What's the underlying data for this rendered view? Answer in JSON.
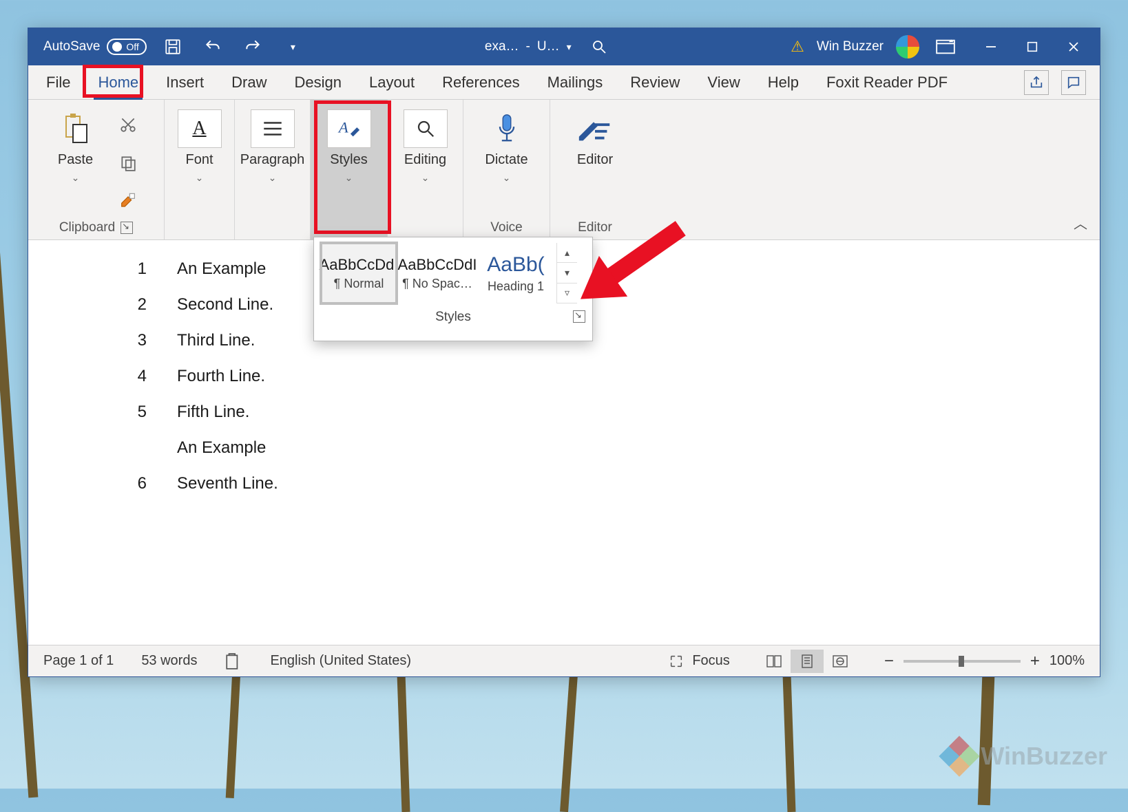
{
  "titlebar": {
    "autosave_label": "AutoSave",
    "autosave_state": "Off",
    "doc_name": "exa…",
    "doc_sep": "-",
    "doc_save": "U…",
    "user_name": "Win Buzzer"
  },
  "tabs": {
    "items": [
      "File",
      "Home",
      "Insert",
      "Draw",
      "Design",
      "Layout",
      "References",
      "Mailings",
      "Review",
      "View",
      "Help",
      "Foxit Reader PDF"
    ],
    "active_index": 1
  },
  "ribbon": {
    "clipboard": {
      "paste": "Paste",
      "group_label": "Clipboard"
    },
    "font": {
      "label": "Font"
    },
    "paragraph": {
      "label": "Paragraph"
    },
    "styles": {
      "label": "Styles"
    },
    "editing": {
      "label": "Editing"
    },
    "dictate": {
      "label": "Dictate",
      "group_label": "Voice"
    },
    "editor": {
      "label": "Editor",
      "group_label": "Editor"
    }
  },
  "styles_gallery": {
    "sample_text": "AaBbCcDdI",
    "heading_sample": "AaBb(",
    "items": [
      {
        "name": "¶ Normal"
      },
      {
        "name": "¶ No Spac…"
      },
      {
        "name": "Heading 1"
      }
    ],
    "footer": "Styles"
  },
  "document": {
    "lines": [
      {
        "n": "1",
        "t": "An Example"
      },
      {
        "n": "2",
        "t": "Second Line."
      },
      {
        "n": "3",
        "t": "Third Line."
      },
      {
        "n": "4",
        "t": "Fourth Line."
      },
      {
        "n": "5",
        "t": "Fifth Line."
      },
      {
        "n": "",
        "t": "An Example"
      },
      {
        "n": "6",
        "t": "Seventh Line."
      }
    ]
  },
  "statusbar": {
    "page": "Page 1 of 1",
    "words": "53 words",
    "language": "English (United States)",
    "focus": "Focus",
    "zoom": "100%"
  },
  "watermark": "WinBuzzer"
}
